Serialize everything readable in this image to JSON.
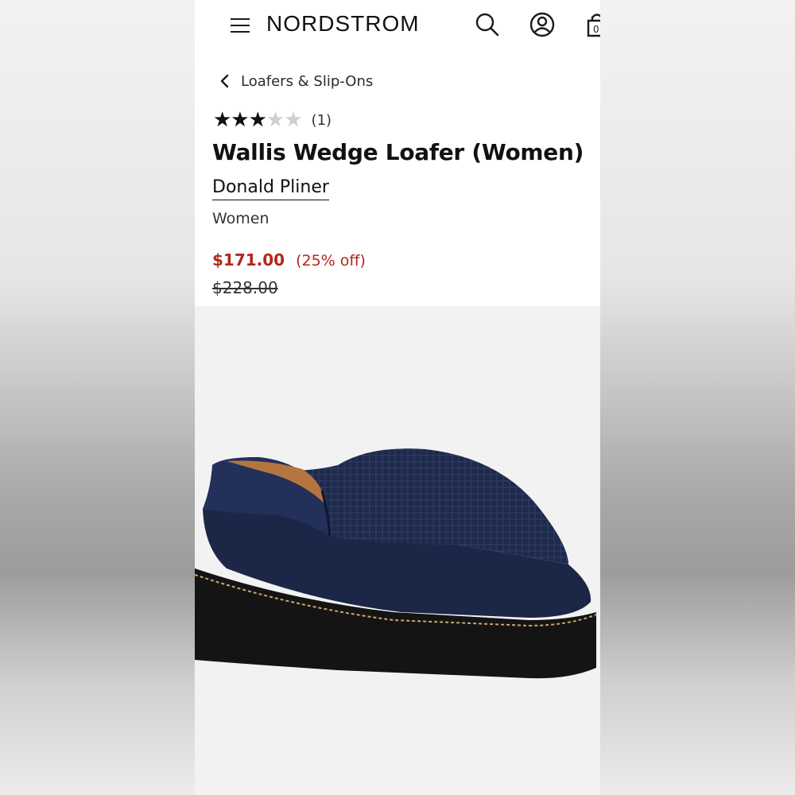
{
  "header": {
    "logo": "NORDSTROM",
    "icons": [
      "menu-icon",
      "search-icon",
      "account-icon",
      "bag-icon"
    ]
  },
  "breadcrumb": {
    "label": "Loafers & Slip-Ons"
  },
  "product": {
    "rating_stars": "★★★★★",
    "rating_value": 3,
    "rating_max": 5,
    "review_count": "(1)",
    "title": "Wallis Wedge Loafer (Women)",
    "brand": "Donald Pliner",
    "category": "Women",
    "sale_price": "$171.00",
    "discount": "(25% off)",
    "original_price": "$228.00"
  },
  "colors": {
    "sale": "#b3271e",
    "text": "#111111",
    "star_empty": "#c9cfd3",
    "shoe_upper": "#1e2a4a",
    "shoe_sole": "#151515"
  }
}
